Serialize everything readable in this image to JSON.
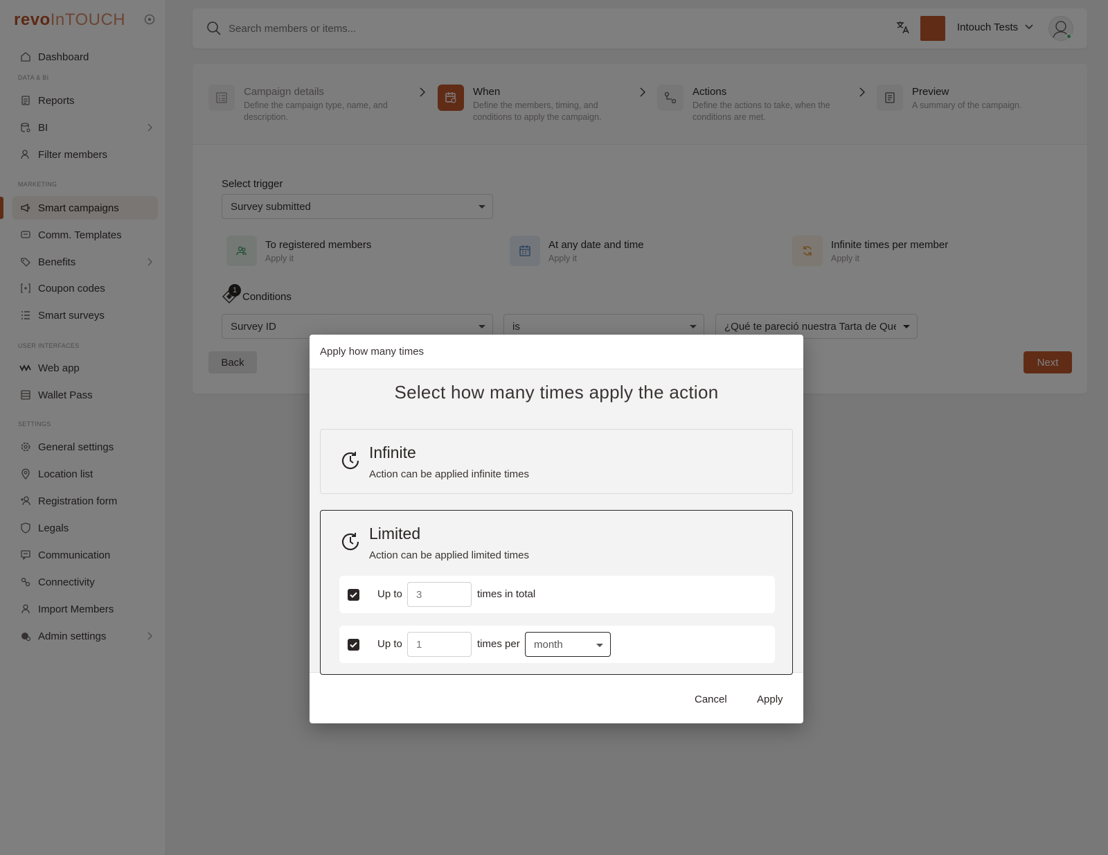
{
  "brand": {
    "logo_part1": "revo",
    "logo_part2": "InTOUCH",
    "accent_color": "#c0592d"
  },
  "sidebar": {
    "sections": {
      "data_bi": "DATA & BI",
      "marketing": "MARKETING",
      "user_interfaces": "USER INTERFACES",
      "settings": "SETTINGS"
    },
    "items": [
      {
        "label": "Dashboard",
        "icon": "home-icon"
      },
      {
        "label": "Reports",
        "icon": "reports-icon"
      },
      {
        "label": "BI",
        "icon": "bi-icon"
      },
      {
        "label": "Filter members",
        "icon": "filter-members-icon"
      },
      {
        "label": "Smart campaigns",
        "icon": "megaphone-icon",
        "active": true
      },
      {
        "label": "Comm. Templates",
        "icon": "message-icon"
      },
      {
        "label": "Benefits",
        "icon": "tag-icon"
      },
      {
        "label": "Coupon codes",
        "icon": "coupon-icon"
      },
      {
        "label": "Smart surveys",
        "icon": "list-icon"
      },
      {
        "label": "Web app",
        "icon": "web-app-icon"
      },
      {
        "label": "Wallet Pass",
        "icon": "wallet-icon"
      },
      {
        "label": "General settings",
        "icon": "gear-icon"
      },
      {
        "label": "Location list",
        "icon": "location-pin-icon"
      },
      {
        "label": "Registration form",
        "icon": "user-add-icon"
      },
      {
        "label": "Legals",
        "icon": "shield-icon"
      },
      {
        "label": "Communication",
        "icon": "communication-icon"
      },
      {
        "label": "Connectivity",
        "icon": "connectivity-icon"
      },
      {
        "label": "Import Members",
        "icon": "import-members-icon"
      },
      {
        "label": "Admin settings",
        "icon": "admin-icon"
      }
    ]
  },
  "topbar": {
    "search_placeholder": "Search members or items...",
    "account_name": "Intouch Tests"
  },
  "stepper": [
    {
      "title": "Campaign details",
      "desc": "Define the campaign type, name, and description."
    },
    {
      "title": "When",
      "desc": "Define the members, timing, and conditions to apply the campaign."
    },
    {
      "title": "Actions",
      "desc": "Define the actions to take, when the conditions are met."
    },
    {
      "title": "Preview",
      "desc": "A summary of the campaign."
    }
  ],
  "form": {
    "trigger_label": "Select trigger",
    "trigger_value": "Survey submitted",
    "chips": [
      {
        "title": "To registered members",
        "sub": "Apply it"
      },
      {
        "title": "At any date and time",
        "sub": "Apply it"
      },
      {
        "title": "Infinite times per member",
        "sub": "Apply it"
      }
    ],
    "conditions_label": "Conditions",
    "conditions_count": "1",
    "condition_field": "Survey ID",
    "condition_operator": "is",
    "condition_value": "¿Qué te pareció nuestra Tarta de Queso?",
    "back_label": "Back",
    "next_label": "Next"
  },
  "modal": {
    "header": "Apply how many times",
    "title": "Select how many times apply the action",
    "options": [
      {
        "title": "Infinite",
        "sub": "Action can be applied infinite times"
      },
      {
        "title": "Limited",
        "sub": "Action can be applied limited times",
        "selected": true
      }
    ],
    "limits": {
      "row1": {
        "up_to": "Up to",
        "value": "3",
        "suffix": "times in total",
        "checked": true
      },
      "row2": {
        "up_to": "Up to",
        "value": "1",
        "suffix": "times per",
        "period": "month",
        "checked": true
      }
    },
    "cancel_label": "Cancel",
    "apply_label": "Apply"
  }
}
